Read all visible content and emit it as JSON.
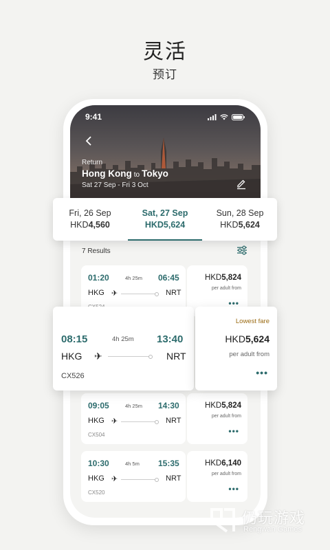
{
  "promo": {
    "headline": "灵活",
    "subline": "预订"
  },
  "status": {
    "time": "9:41"
  },
  "hero": {
    "label": "Return",
    "origin": "Hong Kong",
    "connector": "to",
    "destination": "Tokyo",
    "dates": "Sat 27 Sep - Fri 3 Oct"
  },
  "date_tabs": [
    {
      "date": "Fri, 26 Sep",
      "currency": "HKD",
      "amount": "4,560",
      "active": false
    },
    {
      "date": "Sat, 27 Sep",
      "currency": "HKD",
      "amount": "5,624",
      "active": true
    },
    {
      "date": "Sun, 28 Sep",
      "currency": "HKD",
      "amount": "5,624",
      "active": false
    }
  ],
  "results": {
    "count_label": "7 Results"
  },
  "flights": [
    {
      "dep": "01:20",
      "arr": "06:45",
      "duration": "4h 25m",
      "from": "HKG",
      "to": "NRT",
      "flight_no": "CX524",
      "currency": "HKD",
      "amount": "5,824",
      "per": "per adult from"
    },
    {
      "dep": "08:15",
      "arr": "13:40",
      "duration": "4h 25m",
      "from": "HKG",
      "to": "NRT",
      "flight_no": "CX526",
      "currency": "HKD",
      "amount": "5,624",
      "per": "per adult from",
      "badge": "Lowest fare"
    },
    {
      "dep": "09:05",
      "arr": "14:30",
      "duration": "4h 25m",
      "from": "HKG",
      "to": "NRT",
      "flight_no": "CX504",
      "currency": "HKD",
      "amount": "5,824",
      "per": "per adult from"
    },
    {
      "dep": "10:30",
      "arr": "15:35",
      "duration": "4h 5m",
      "from": "HKG",
      "to": "NRT",
      "flight_no": "CX520",
      "currency": "HKD",
      "amount": "6,140",
      "per": "per adult from"
    }
  ],
  "more_glyph": "•••",
  "watermark": {
    "name": "仍玩游戏",
    "sub": "Rengwan Games"
  },
  "colors": {
    "accent": "#2c6b6c",
    "badge": "#9a6a12"
  }
}
